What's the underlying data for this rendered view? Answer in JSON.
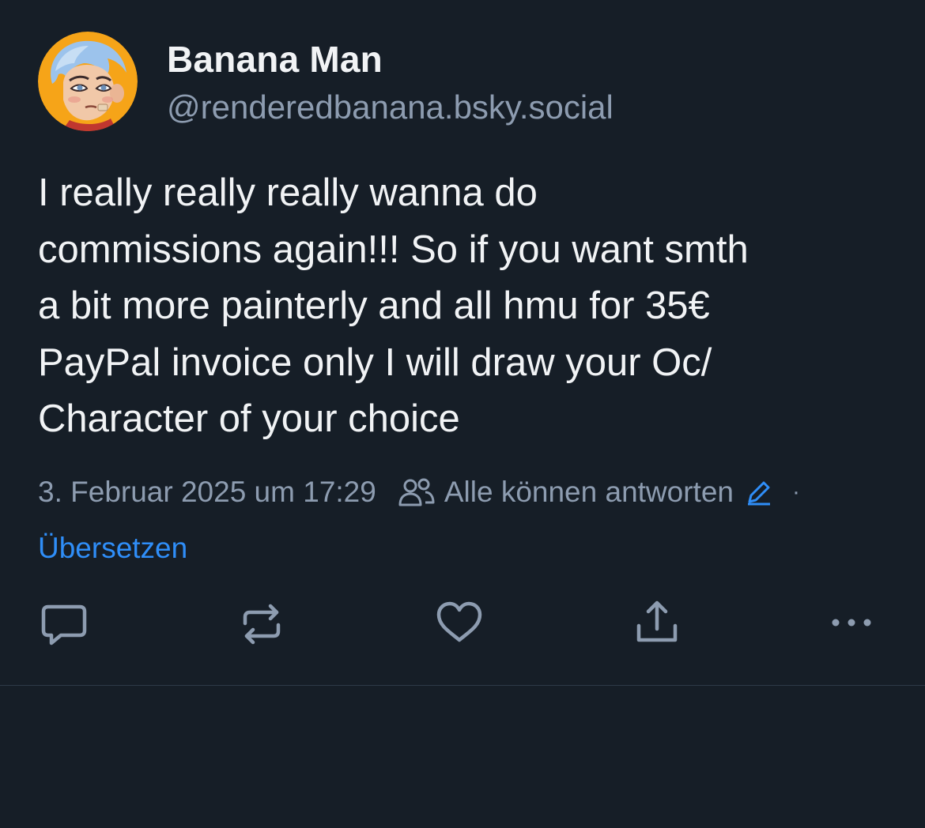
{
  "post": {
    "author": {
      "display_name": "Banana Man",
      "handle": "@renderedbanana.bsky.social",
      "avatar_icon": "cartoon-character-avatar"
    },
    "text": "I really really really wanna do\ncommissions again!!! So if you want smth\na bit more painterly and all hmu for 35€\nPayPal invoice only I will draw your Oc/\nCharacter of your choice",
    "timestamp": "3. Februar 2025 um 17:29",
    "reply_setting": "Alle können antworten",
    "separator": "·",
    "translate_label": "Übersetzen"
  },
  "actions": {
    "reply_icon": "speech-bubble-icon",
    "repost_icon": "repost-icon",
    "like_icon": "heart-icon",
    "share_icon": "share-icon",
    "more_icon": "more-dots-icon"
  },
  "colors": {
    "background": "#161e27",
    "text": "#f1f3f5",
    "muted": "#8d9cb0",
    "link": "#2f8ef8",
    "avatar_ring": "#f6a418"
  }
}
